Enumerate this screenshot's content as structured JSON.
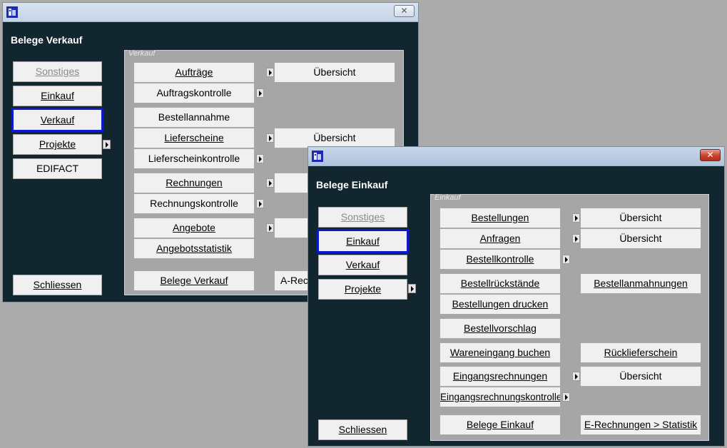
{
  "verkauf": {
    "title": "Belege Verkauf",
    "panel_label": "Verkauf",
    "nav": [
      "Sonstiges",
      "Einkauf",
      "Verkauf",
      "Projekte",
      "EDIFACT"
    ],
    "close_label": "Schliessen",
    "buttons": [
      "Aufträge",
      "Auftragskontrolle",
      "Bestellannahme",
      "Lieferscheine",
      "Lieferscheinkontrolle",
      "Rechnungen",
      "Rechnungskontrolle",
      "Angebote",
      "Angebotsstatistik",
      "Belege Verkauf"
    ],
    "right_buttons": [
      "Übersicht",
      "Übersicht",
      "A-Rec"
    ]
  },
  "einkauf": {
    "title": "Belege Einkauf",
    "panel_label": "Einkauf",
    "nav": [
      "Sonstiges",
      "Einkauf",
      "Verkauf",
      "Projekte"
    ],
    "close_label": "Schliessen",
    "buttons": [
      "Bestellungen",
      "Anfragen",
      "Bestellkontrolle",
      "Bestellrückstände",
      "Bestellungen drucken",
      "Bestellvorschlag",
      "Wareneingang buchen",
      "Eingangsrechnungen",
      "Eingangsrechnungskontrolle",
      "Belege Einkauf"
    ],
    "right_buttons": [
      "Übersicht",
      "Übersicht",
      "Bestellanmahnungen",
      "Rücklieferschein",
      "Übersicht",
      "E-Rechnungen > Statistik"
    ]
  },
  "colors": {
    "window_bg": "#12262f",
    "panel_bg": "#a6a6a6",
    "selected_border": "#0c1acb",
    "desktop": "#ababab"
  },
  "icons": {
    "app": "app-icon",
    "close": "close-icon",
    "submenu": "submenu-arrow-icon"
  }
}
